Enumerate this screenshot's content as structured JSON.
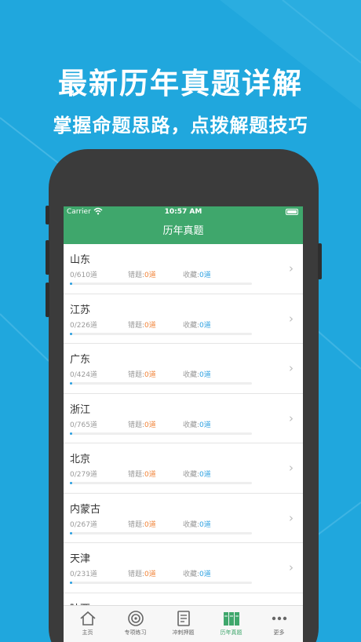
{
  "promo": {
    "title": "最新历年真题详解",
    "subtitle": "掌握命题思路，点拨解题技巧"
  },
  "status_bar": {
    "carrier": "Carrier",
    "time": "10:57 AM"
  },
  "nav": {
    "title": "历年真题"
  },
  "provinces": [
    {
      "name": "山东",
      "progress": "0/610道",
      "wrong_label": "错题:",
      "wrong_count": "0道",
      "fav_label": "收藏:",
      "fav_count": "0道"
    },
    {
      "name": "江苏",
      "progress": "0/226道",
      "wrong_label": "错题:",
      "wrong_count": "0道",
      "fav_label": "收藏:",
      "fav_count": "0道"
    },
    {
      "name": "广东",
      "progress": "0/424道",
      "wrong_label": "错题:",
      "wrong_count": "0道",
      "fav_label": "收藏:",
      "fav_count": "0道"
    },
    {
      "name": "浙江",
      "progress": "0/765道",
      "wrong_label": "错题:",
      "wrong_count": "0道",
      "fav_label": "收藏:",
      "fav_count": "0道"
    },
    {
      "name": "北京",
      "progress": "0/279道",
      "wrong_label": "错题:",
      "wrong_count": "0道",
      "fav_label": "收藏:",
      "fav_count": "0道"
    },
    {
      "name": "内蒙古",
      "progress": "0/267道",
      "wrong_label": "错题:",
      "wrong_count": "0道",
      "fav_label": "收藏:",
      "fav_count": "0道"
    },
    {
      "name": "天津",
      "progress": "0/231道",
      "wrong_label": "错题:",
      "wrong_count": "0道",
      "fav_label": "收藏:",
      "fav_count": "0道"
    },
    {
      "name": "陕西",
      "progress": "",
      "wrong_label": "",
      "wrong_count": "",
      "fav_label": "",
      "fav_count": ""
    }
  ],
  "tabs": [
    {
      "label": "主页",
      "icon": "home-icon"
    },
    {
      "label": "专项练习",
      "icon": "target-icon"
    },
    {
      "label": "冲刺押题",
      "icon": "document-icon"
    },
    {
      "label": "历年真题",
      "icon": "books-icon",
      "active": true
    },
    {
      "label": "更多",
      "icon": "more-icon"
    }
  ],
  "colors": {
    "background": "#20a7dd",
    "primary_green": "#3fa76c",
    "wrong_orange": "#f08236",
    "fav_blue": "#2a9fe0"
  }
}
